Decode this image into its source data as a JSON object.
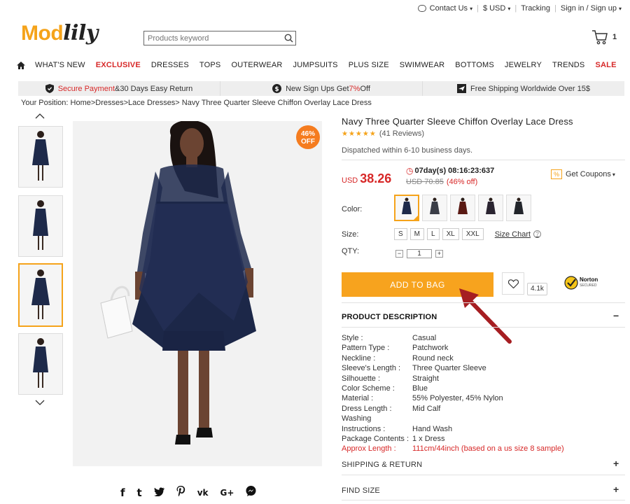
{
  "topbar": {
    "contact": "Contact Us",
    "currency": "$ USD",
    "tracking": "Tracking",
    "signin": "Sign in / Sign up"
  },
  "logo": {
    "part1": "Mod",
    "part2": "lily"
  },
  "search": {
    "placeholder": "Products keyword"
  },
  "cart": {
    "count": "1"
  },
  "nav": {
    "items": [
      "WHAT'S NEW",
      "EXCLUSIVE",
      "DRESSES",
      "TOPS",
      "OUTERWEAR",
      "JUMPSUITS",
      "PLUS SIZE",
      "SWIMWEAR",
      "BOTTOMS",
      "JEWELRY",
      "TRENDS",
      "SALE"
    ]
  },
  "promo": {
    "p1_red": "Secure Payment",
    "p1_rest": " &30 Days Easy Return",
    "p2_a": "New Sign Ups Get ",
    "p2_red": "7%",
    "p2_b": " Off",
    "p3": "Free Shipping Worldwide Over 15$"
  },
  "breadcrumb": "Your Position: Home>Dresses>Lace Dresses> Navy Three Quarter Sleeve Chiffon Overlay Lace Dress",
  "badge": {
    "pct": "46%",
    "off": "OFF"
  },
  "product": {
    "title": "Navy Three Quarter Sleeve Chiffon Overlay Lace Dress",
    "stars": "★★★★★",
    "reviews": "(41 Reviews)",
    "dispatch": "Dispatched within 6-10 business days.",
    "currency": "USD",
    "price": "38.26",
    "timer": "07day(s) 08:16:23:637",
    "old_price": "USD 70.85",
    "discount": "(46% off)",
    "coupon": "Get Coupons",
    "color_label": "Color:",
    "size_label": "Size:",
    "sizes": [
      "S",
      "M",
      "L",
      "XL",
      "XXL"
    ],
    "size_chart": "Size Chart",
    "qty_label": "QTY:",
    "qty": "1",
    "add_to_bag": "ADD TO BAG",
    "wish_count": "4.1k",
    "norton": "Norton",
    "norton_sub": "SECURED"
  },
  "swatch_colors": [
    "#1e2a4a",
    "#3a3d47",
    "#5a1a14",
    "#2a2430",
    "#22252b"
  ],
  "description": {
    "heading": "PRODUCT DESCRIPTION",
    "specs": [
      {
        "k": "Style :",
        "v": "Casual"
      },
      {
        "k": "Pattern Type :",
        "v": "Patchwork"
      },
      {
        "k": "Neckline :",
        "v": "Round neck"
      },
      {
        "k": "Sleeve's Length :",
        "v": "Three Quarter Sleeve"
      },
      {
        "k": "Silhouette :",
        "v": "Straight"
      },
      {
        "k": "Color Scheme :",
        "v": "Blue"
      },
      {
        "k": "Material :",
        "v": "55% Polyester, 45% Nylon"
      },
      {
        "k": "Dress Length :",
        "v": "Mid Calf"
      },
      {
        "k": "Washing",
        "v": ""
      },
      {
        "k": "Instructions :",
        "v": "Hand Wash"
      },
      {
        "k": "Package Contents :",
        "v": "1 x Dress"
      },
      {
        "k": "Approx Length :",
        "v": "111cm/44inch (based on a us size 8 sample)"
      }
    ]
  },
  "sections": {
    "shipping": "SHIPPING & RETURN",
    "findsize": "FIND SIZE"
  },
  "colors": {
    "accent": "#f7a31e",
    "red": "#d72828",
    "navy": "#1e2a4a"
  }
}
